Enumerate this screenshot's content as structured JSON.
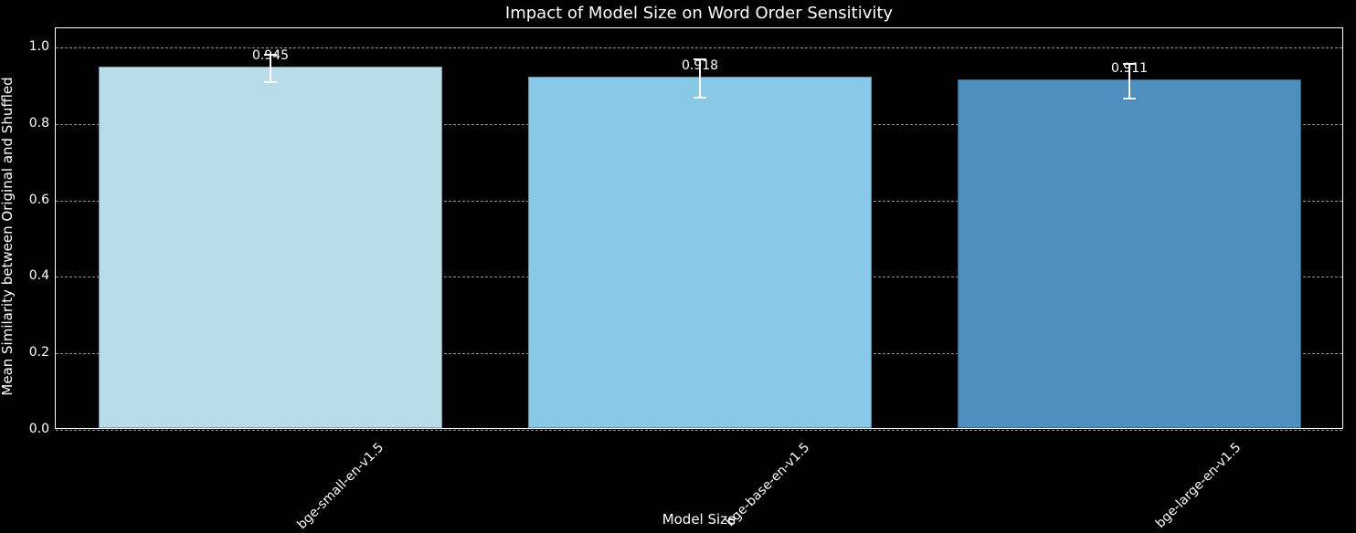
{
  "chart_data": {
    "type": "bar",
    "title": "Impact of Model Size on Word Order Sensitivity",
    "xlabel": "Model Size",
    "ylabel": "Mean Similarity between Original and Shuffled",
    "categories": [
      "bge-small-en-v1.5",
      "bge-base-en-v1.5",
      "bge-large-en-v1.5"
    ],
    "values": [
      0.945,
      0.918,
      0.911
    ],
    "value_labels": [
      "0.945",
      "0.918",
      "0.911"
    ],
    "errors": [
      0.035,
      0.05,
      0.045
    ],
    "colors": [
      "#b8dde8",
      "#88c9e8",
      "#4f8fbf"
    ],
    "ylim": [
      0.0,
      1.05
    ],
    "yticks": [
      0.0,
      0.2,
      0.4,
      0.6,
      0.8,
      1.0
    ],
    "ytick_labels": [
      "0.0",
      "0.2",
      "0.4",
      "0.6",
      "0.8",
      "1.0"
    ]
  }
}
